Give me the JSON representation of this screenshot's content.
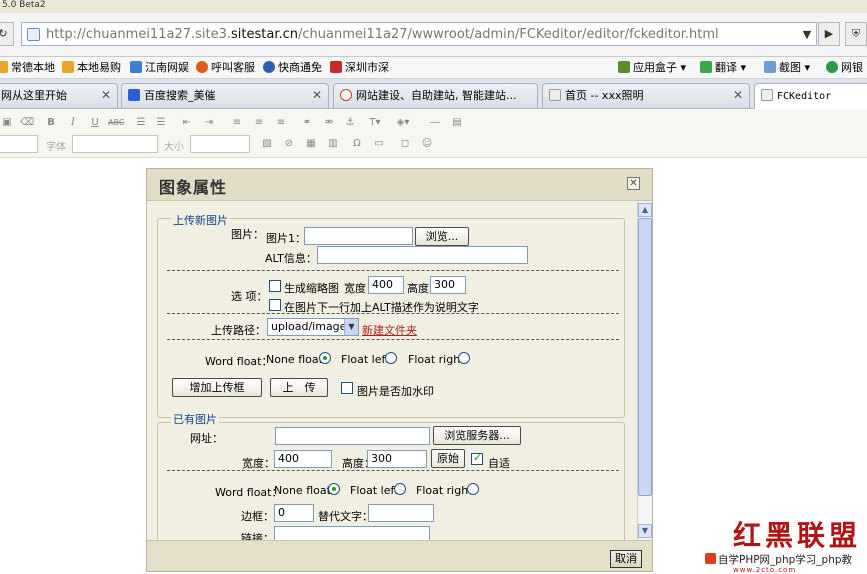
{
  "browser": {
    "title_strip": "5.0 Beta2",
    "url_prefix": "http://chuanmei11a27.site3.",
    "url_domain": "sitestar.cn",
    "url_suffix": "/chuanmei11a27/wwwroot/admin/FCKeditor/editor/fckeditor.html"
  },
  "favorites": {
    "left": [
      "常德本地",
      "本地易购",
      "江南网娱",
      "呼叫客服",
      "快商通免",
      "深圳市深"
    ],
    "right": [
      "应用盒子",
      "翻译",
      "截图",
      "网银"
    ]
  },
  "tabs": [
    {
      "label": "网从这里开始",
      "active": false
    },
    {
      "label": "百度搜索_美催",
      "active": false
    },
    {
      "label": "网站建设、自助建站, 智能建站...",
      "active": false
    },
    {
      "label": "首页 -- xxx照明",
      "active": false
    },
    {
      "label": "FCKeditor",
      "active": true
    }
  ],
  "editor_toolbar": {
    "font_label": "字体",
    "size_label": "大小"
  },
  "dialog": {
    "title": "图象属性",
    "upload_group": {
      "legend": "上传新图片",
      "image_label": "图片：",
      "image1_label": "图片1：",
      "browse_button": "浏览...",
      "alt_label": "ALT信息：",
      "options_label": "选 项：",
      "thumb_label": "生成缩略图",
      "width_label": "宽度",
      "width_value": "400",
      "height_label": "高度",
      "height_value": "300",
      "alt_caption_label": "在图片下一行加上ALT描述作为说明文字",
      "path_label": "上传路径：",
      "path_value": "upload/image/",
      "new_folder_link": "新建文件夹",
      "float_label": "Word float：",
      "none_float": "None float",
      "float_left": "Float left",
      "float_right": "Float right",
      "add_upload_button": "增加上传框",
      "upload_button": "上　传",
      "watermark_label": "图片是否加水印"
    },
    "existing_group": {
      "legend": "已有图片",
      "url_label": "网址：",
      "browse_server_button": "浏览服务器...",
      "width_label": "宽度：",
      "width_value": "400",
      "height_label": "高度：",
      "height_value": "300",
      "original_button": "原始",
      "auto_label": "自适",
      "float_label": "Word float：",
      "none_float": "None float",
      "float_left": "Float left",
      "float_right": "Float right",
      "border_label": "边框：",
      "border_value": "0",
      "alt_text_label": "替代文字：",
      "link_label": "链接："
    },
    "cancel_button": "取消"
  },
  "watermark": {
    "title": "红黑联盟",
    "line": "自学PHP网_php学习_php教",
    "sub": "www.2cto.com"
  },
  "colors": {
    "dialog_bg": "#f1efe2",
    "legend_text": "#15428b",
    "radio_checked": "#21a121",
    "link_red": "#b0201c"
  }
}
